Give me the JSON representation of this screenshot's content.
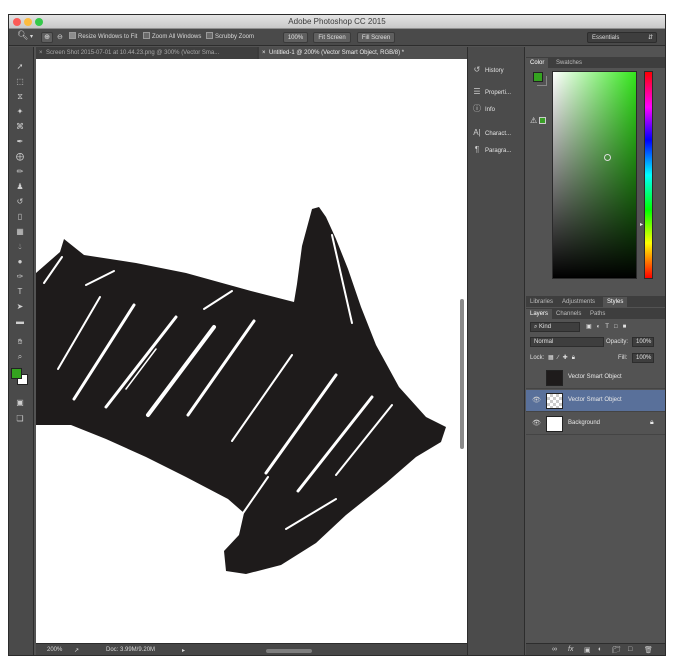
{
  "window": {
    "title": "Adobe Photoshop CC 2015"
  },
  "options_bar": {
    "zoom_tool_icon": "magnifier-icon",
    "resize_windows_label": "Resize Windows to Fit",
    "zoom_all_label": "Zoom All Windows",
    "scrubby_zoom_label": "Scrubby Zoom",
    "zoom_value": "100%",
    "fit_screen_label": "Fit Screen",
    "fill_screen_label": "Fill Screen",
    "workspace_label": "Essentials"
  },
  "tabs": [
    {
      "label": "Screen Shot 2015-07-01 at 10.44.23.png @ 300% (Vector Sma..."
    },
    {
      "label": "Untitled-1 @ 200% (Vector Smart Object, RGB/8) *"
    }
  ],
  "status_bar": {
    "zoom": "200%",
    "doc": "Doc: 3.99M/9.20M"
  },
  "icon_panel": [
    {
      "label": "History",
      "icon": "history-icon"
    },
    {
      "label": "Properti...",
      "icon": "properties-icon"
    },
    {
      "label": "Info",
      "icon": "info-icon"
    },
    {
      "label": "Charact...",
      "icon": "character-icon"
    },
    {
      "label": "Paragra...",
      "icon": "paragraph-icon"
    }
  ],
  "color_panel": {
    "tabs": [
      "Color",
      "Swatches"
    ],
    "foreground": "#34a31f",
    "hue_color": "#34e61c"
  },
  "lib_panel": {
    "tabs": [
      "Libraries",
      "Adjustments",
      "Styles"
    ]
  },
  "layers_panel": {
    "tabs": [
      "Layers",
      "Channels",
      "Paths"
    ],
    "kind_label": "Kind",
    "blend_mode": "Normal",
    "opacity_label": "Opacity:",
    "opacity_value": "100%",
    "lock_label": "Lock:",
    "fill_label": "Fill:",
    "fill_value": "100%",
    "layers": [
      {
        "name": "Vector Smart Object",
        "visible": false,
        "selected": false
      },
      {
        "name": "Vector Smart Object",
        "visible": true,
        "selected": true
      },
      {
        "name": "Background",
        "visible": true,
        "selected": false
      }
    ]
  }
}
